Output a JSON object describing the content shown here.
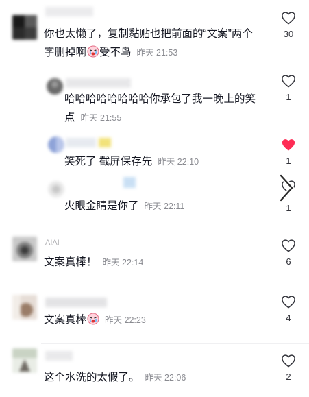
{
  "comments": [
    {
      "text": "你也太懒了，复制黏贴也把前面的“文案”两个字删掉啊",
      "emoji": "crying-face-emoji",
      "text_after": "受不鸟",
      "time": "昨天 21:53",
      "likes": "30",
      "liked": false
    },
    {
      "text": "哈哈哈哈哈哈哈哈你承包了我一晚上的笑点",
      "time": "昨天 21:55",
      "likes": "1",
      "liked": false
    },
    {
      "text": "笑死了 截屏保存先",
      "time": "昨天 22:10",
      "likes": "1",
      "liked": true
    },
    {
      "text": "火眼金睛是你了",
      "time": "昨天 22:11",
      "likes": "1",
      "liked": false
    },
    {
      "username": "AIAI",
      "text": "文案真棒！",
      "time": "昨天 22:14",
      "likes": "6",
      "liked": false
    },
    {
      "text": "文案真棒",
      "emoji": "crying-face-emoji",
      "time": "昨天 22:23",
      "likes": "4",
      "liked": false
    },
    {
      "text": "这个水洗的太假了。",
      "time": "昨天 22:06",
      "likes": "2",
      "liked": false
    }
  ],
  "colors": {
    "liked_heart": "#fe2c55",
    "text": "#161823",
    "time": "#8a8b91"
  },
  "icons": {
    "like": "heart-outline-icon",
    "liked": "heart-filled-icon",
    "swipe": "chevron-right-icon"
  }
}
